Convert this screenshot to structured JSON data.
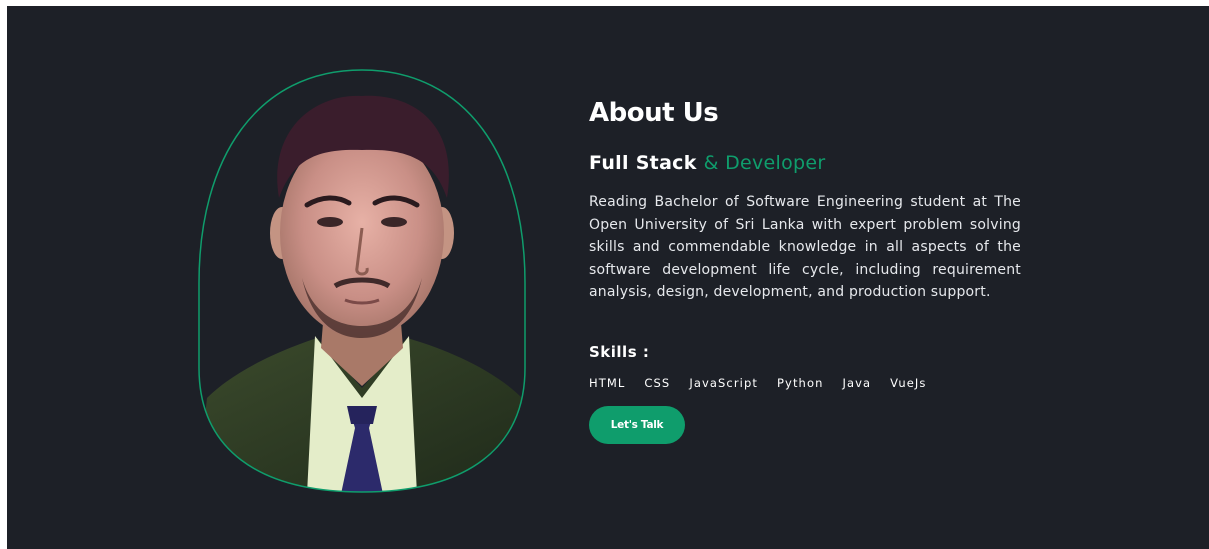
{
  "about": {
    "title": "About Us",
    "subtitle_main": "Full Stack",
    "subtitle_accent": "& Developer",
    "description": "Reading Bachelor of Software Engineering student at The Open University of Sri Lanka with expert problem solving skills and commendable knowledge in all aspects of the software development life cycle, including requirement analysis, design, development, and production support.",
    "skills_label": "Skills :",
    "skills": [
      "HTML",
      "CSS",
      "JavaScript",
      "Python",
      "Java",
      "VueJs"
    ],
    "cta_label": "Let's Talk"
  },
  "colors": {
    "background": "#1d2027",
    "accent": "#0f9d6c",
    "text": "#ffffff"
  },
  "icons": {
    "portrait": "profile-photo"
  }
}
